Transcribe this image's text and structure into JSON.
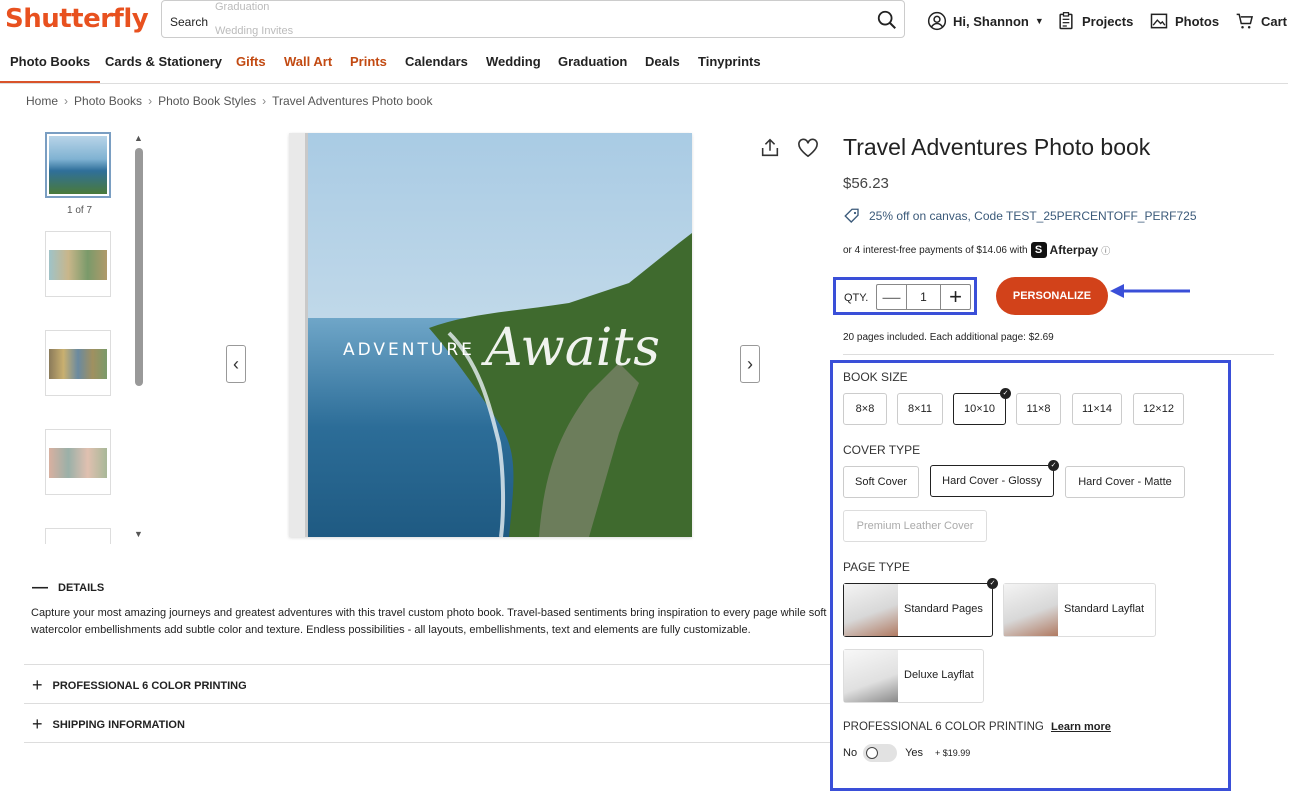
{
  "header": {
    "logo": "Shutterfly",
    "search_label": "Search",
    "search_placeholder_1": "Graduation",
    "search_placeholder_2": "Wedding Invites",
    "account": "Hi, Shannon",
    "projects": "Projects",
    "photos": "Photos",
    "cart": "Cart"
  },
  "nav": [
    "Photo Books",
    "Cards & Stationery",
    "Gifts",
    "Wall Art",
    "Prints",
    "Calendars",
    "Wedding",
    "Graduation",
    "Deals",
    "Tinyprints"
  ],
  "breadcrumb": [
    "Home",
    "Photo Books",
    "Photo Book Styles",
    "Travel Adventures Photo book"
  ],
  "gallery": {
    "counter": "1 of 7",
    "cover_text_1": "ADVENTURE",
    "cover_text_2": "Awaits"
  },
  "product": {
    "title": "Travel Adventures Photo book",
    "price": "$56.23",
    "promo": "25% off on canvas, Code TEST_25PERCENTOFF_PERF725",
    "afterpay_text": "or 4 interest-free payments of $14.06 with",
    "afterpay_name": "Afterpay",
    "qty_label": "QTY.",
    "qty_value": "1",
    "personalize": "PERSONALIZE",
    "pages_note": "20 pages included. Each additional page: $2.69"
  },
  "options": {
    "book_size_label": "BOOK SIZE",
    "book_sizes": [
      "8×8",
      "8×11",
      "10×10",
      "11×8",
      "11×14",
      "12×12"
    ],
    "book_size_selected": "10×10",
    "cover_type_label": "COVER TYPE",
    "cover_types": [
      "Soft Cover",
      "Hard Cover - Glossy",
      "Hard Cover - Matte",
      "Premium Leather Cover"
    ],
    "cover_type_selected": "Hard Cover - Glossy",
    "page_type_label": "PAGE TYPE",
    "page_types": [
      "Standard Pages",
      "Standard Layflat",
      "Deluxe Layflat"
    ],
    "page_type_selected": "Standard Pages",
    "printing_label": "PROFESSIONAL 6 COLOR PRINTING",
    "learn_more": "Learn more",
    "toggle_no": "No",
    "toggle_yes": "Yes",
    "addon_price": "+ $19.99"
  },
  "details": {
    "header": "DETAILS",
    "text": "Capture your most amazing journeys and greatest adventures with this travel custom photo book. Travel-based sentiments bring inspiration to every page while soft watercolor embellishments add subtle color and texture. Endless possibilities - all layouts, embellishments, text and elements are fully customizable.",
    "acc_printing": "PROFESSIONAL 6 COLOR PRINTING",
    "acc_shipping": "SHIPPING INFORMATION"
  },
  "colors": {
    "brand": "#e8511f",
    "cta": "#d2421a",
    "highlight": "#3a4fd8"
  }
}
